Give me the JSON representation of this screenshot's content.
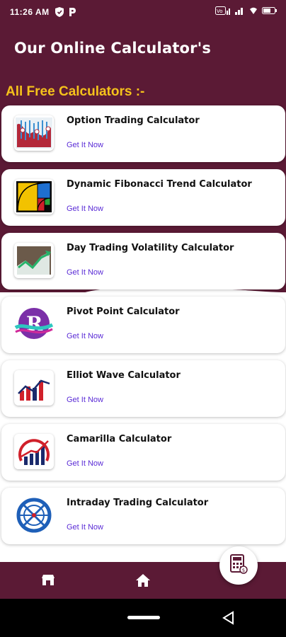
{
  "status_bar": {
    "time": "11:26 AM",
    "left_icons": [
      "shield-icon",
      "p-icon"
    ],
    "right_icons": [
      "volte-icon",
      "signal-icon",
      "wifi-icon",
      "battery-icon"
    ]
  },
  "header": {
    "title": "Our Online Calculator's"
  },
  "section": {
    "title": "All Free Calculators :-"
  },
  "cards": [
    {
      "title": "Option Trading Calculator",
      "link": "Get It Now",
      "icon": "option-chart-icon"
    },
    {
      "title": "Dynamic Fibonacci Trend Calculator",
      "link": "Get It Now",
      "icon": "fibonacci-icon"
    },
    {
      "title": "Day Trading Volatility Calculator",
      "link": "Get It Now",
      "icon": "volatility-chart-icon"
    },
    {
      "title": "Pivot Point Calculator",
      "link": "Get It Now",
      "icon": "pivot-logo-icon"
    },
    {
      "title": "Elliot Wave Calculator",
      "link": "Get It Now",
      "icon": "elliot-bars-icon"
    },
    {
      "title": "Camarilla Calculator",
      "link": "Get It Now",
      "icon": "camarilla-chart-icon"
    },
    {
      "title": "Intraday Trading Calculator",
      "link": "Get It Now",
      "icon": "intraday-logo-icon"
    }
  ],
  "colors": {
    "primary": "#5b1a35",
    "accent": "#f5c21b",
    "link": "#5a2bd6"
  },
  "bottom_nav": {
    "items": [
      "store-icon",
      "home-icon"
    ],
    "fab": "calculator-icon"
  }
}
